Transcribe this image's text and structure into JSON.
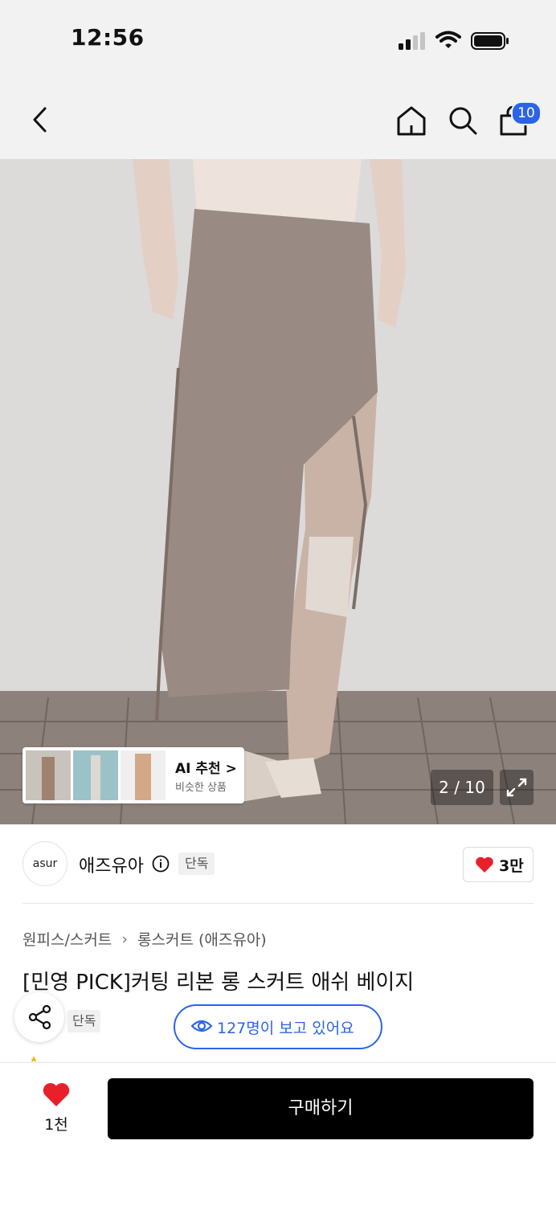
{
  "status_bar": {
    "time": "12:56",
    "signal_icon": "signal-icon",
    "wifi_icon": "wifi-icon",
    "battery_icon": "battery-icon"
  },
  "nav": {
    "back_icon": "chevron-left-icon",
    "home_icon": "home-icon",
    "search_icon": "search-icon",
    "cart_icon": "shopping-bag-icon",
    "cart_count": "10"
  },
  "gallery": {
    "ai_title": "AI 추천 >",
    "ai_subtitle": "비슷한 상품",
    "counter": "2 / 10",
    "expand_icon": "expand-icon"
  },
  "brand": {
    "logo_text": "asur",
    "name": "애즈유아",
    "badge": "단독",
    "like_count": "3만"
  },
  "product": {
    "breadcrumb": [
      "원피스/스커트",
      "롱스커트 (애즈유아)"
    ],
    "title": "[민영 PICK]커팅 리본 롱 스커트 애쉬 베이지",
    "badge": "단독",
    "viewers": "127명이 보고 있어요"
  },
  "bottom_bar": {
    "like_count": "1천",
    "buy_label": "구매하기"
  },
  "colors": {
    "accent": "#2b64e8",
    "heart": "#e8202a",
    "buy_button": "#000000"
  }
}
